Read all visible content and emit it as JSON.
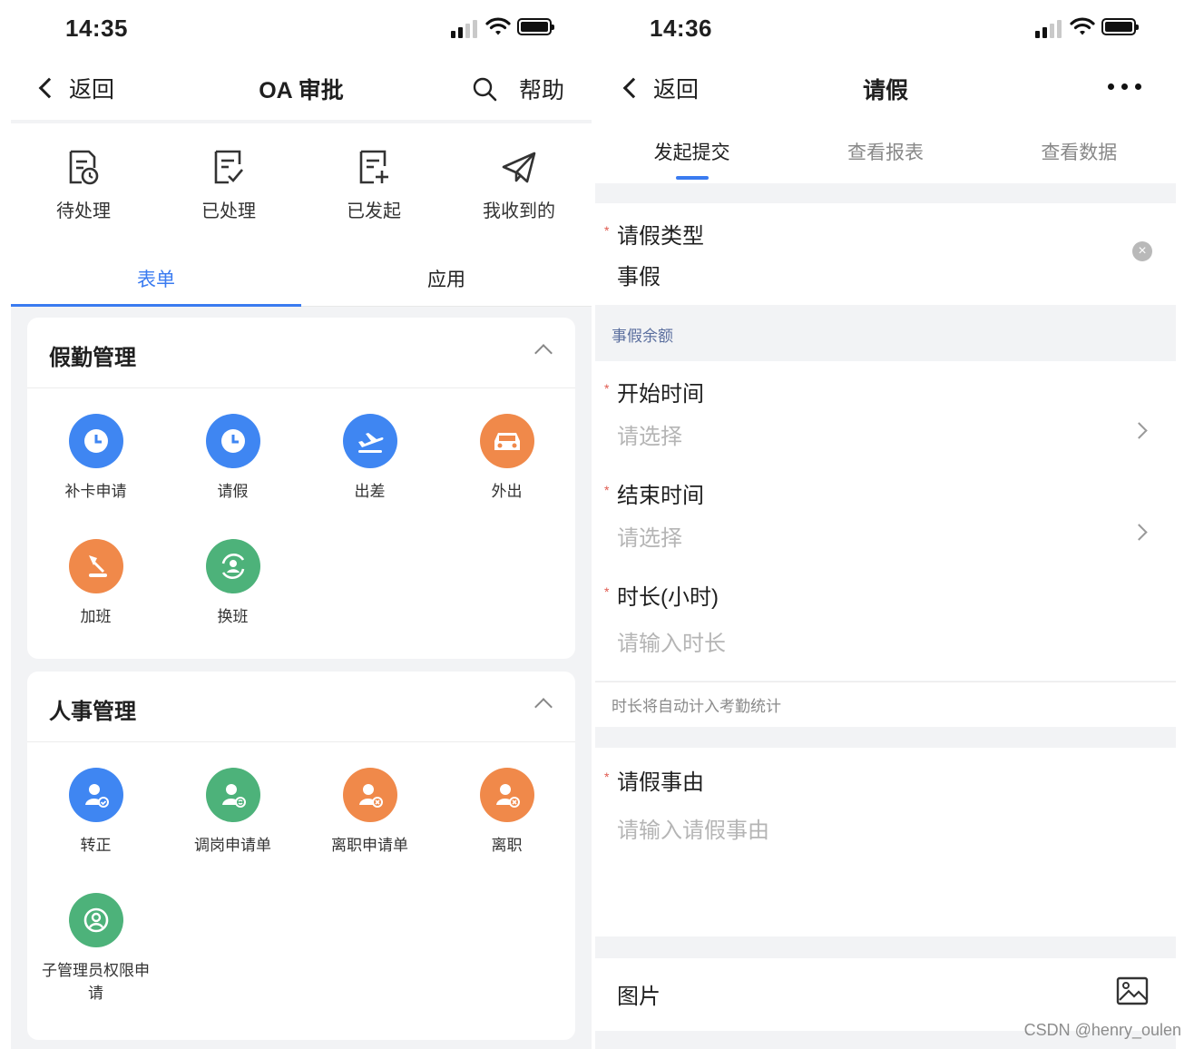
{
  "left": {
    "status": {
      "time": "14:35"
    },
    "nav": {
      "back": "返回",
      "title": "OA 审批",
      "help": "帮助"
    },
    "quick_actions": [
      "待处理",
      "已处理",
      "已发起",
      "我收到的"
    ],
    "tabs": [
      "表单",
      "应用"
    ],
    "sections": [
      {
        "title": "假勤管理",
        "apps": [
          "补卡申请",
          "请假",
          "出差",
          "外出",
          "加班",
          "换班"
        ]
      },
      {
        "title": "人事管理",
        "apps": [
          "转正",
          "调岗申请单",
          "离职申请单",
          "离职",
          "子管理员权限申请"
        ]
      }
    ]
  },
  "right": {
    "status": {
      "time": "14:36"
    },
    "nav": {
      "back": "返回",
      "title": "请假"
    },
    "tabs": [
      "发起提交",
      "查看报表",
      "查看数据"
    ],
    "leave_type": {
      "label": "请假类型",
      "value": "事假"
    },
    "balance_label": "事假余额",
    "start": {
      "label": "开始时间",
      "placeholder": "请选择"
    },
    "end": {
      "label": "结束时间",
      "placeholder": "请选择"
    },
    "duration": {
      "label": "时长(小时)",
      "placeholder": "请输入时长"
    },
    "duration_hint": "时长将自动计入考勤统计",
    "reason": {
      "label": "请假事由",
      "placeholder": "请输入请假事由"
    },
    "image_label": "图片"
  },
  "watermark": "CSDN @henry_oulen",
  "colors": {
    "accent": "#3a7bf0",
    "blue_icon": "#3f86f2",
    "orange_icon": "#f0894a",
    "green_icon": "#4db27a",
    "required": "#e05a4f"
  }
}
